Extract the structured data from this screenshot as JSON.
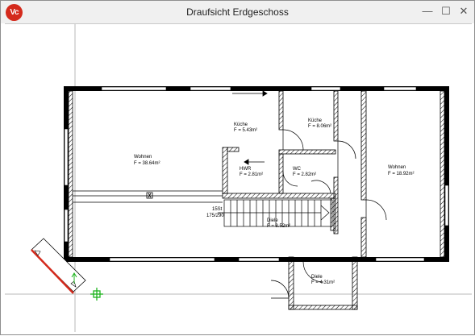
{
  "window": {
    "title": "Draufsicht Erdgeschoss",
    "app_icon_label": "Vc",
    "controls": {
      "minimize": "—",
      "maximize": "☐",
      "close": "✕"
    }
  },
  "rooms": [
    {
      "name": "Wohnen",
      "area": "F = 38.64m²"
    },
    {
      "name": "Küche",
      "area": "F = 5.43m²"
    },
    {
      "name": "Küche",
      "area": "F = 8.06m²"
    },
    {
      "name": "Wohnen",
      "area": "F = 18.92m²"
    },
    {
      "name": "HWR",
      "area": "F = 2.81m²"
    },
    {
      "name": "WC",
      "area": "F = 2.82m²"
    },
    {
      "name": "Diele",
      "area": "F = 8.52m²"
    },
    {
      "name": "Diele",
      "area": "F = 4.31m²"
    }
  ],
  "stairs": {
    "count": "15St",
    "ratio": "175/290"
  },
  "colors": {
    "accent_red": "#d42a1c",
    "wall": "#000000",
    "marker_green": "#1db31d"
  }
}
